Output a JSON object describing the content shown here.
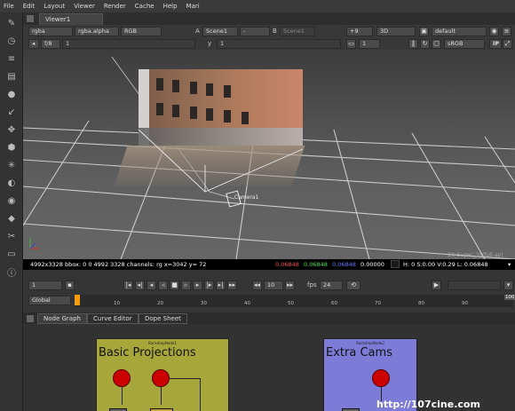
{
  "menu": [
    "File",
    "Edit",
    "Layout",
    "Viewer",
    "Render",
    "Cache",
    "Help",
    "Mari"
  ],
  "viewer_tab": "Viewer1",
  "row1": {
    "channels": "rgba",
    "alpha": "rgba.alpha",
    "colorspace": "RGB",
    "a_label": "A",
    "a_input": "Scene1",
    "compare": "-",
    "b_label": "B",
    "b_input": "Scene1",
    "gain": "+9",
    "view_mode": "3D",
    "cam": "default"
  },
  "row2": {
    "frame": "1",
    "fstop": "f/8",
    "gamma_label": "y",
    "gamma": "1",
    "proxy": "1",
    "lut": "sRGB",
    "ip": "IP"
  },
  "viewport": {
    "camera_label": "Camera1",
    "format": "2K_Super_35(full-ap)"
  },
  "infobar": {
    "text": "4992x3328 bbox: 0 0 4992 3328 channels: rg  x=3042 y=   72",
    "r": "0.06848",
    "g": "0.06848",
    "b": "0.06848",
    "a": "0.00000",
    "hsv": "H:  0 S:0.00 V:0.29  L: 0.06848"
  },
  "timeline": {
    "frame": "1",
    "step": "10",
    "fps_label": "fps",
    "fps": "24",
    "global": "Global",
    "ticks": [
      "1",
      "10",
      "20",
      "30",
      "40",
      "50",
      "60",
      "70",
      "80",
      "90",
      "100"
    ],
    "end": "100"
  },
  "nodegraph_tabs": [
    "Node Graph",
    "Curve Editor",
    "Dope Sheet"
  ],
  "backdrops": [
    {
      "small": "BackdropNode1",
      "title": "Basic Projections",
      "color": "#a6a63a"
    },
    {
      "small": "BackdropNode2",
      "title": "Extra Cams",
      "color": "#7d7bd8"
    }
  ],
  "watermark": "http://107cine.com",
  "colors": {
    "accent": "#ff9a00",
    "red_node": "#cc0000"
  },
  "icons": [
    "paint-brush-icon",
    "circle-icon",
    "layers-icon",
    "channel-icon",
    "sphere-icon",
    "arrow-icon",
    "merge-icon",
    "cube-icon",
    "star-icon",
    "filter-icon",
    "keyer-icon",
    "tag-icon",
    "tool-icon",
    "other-icon"
  ]
}
